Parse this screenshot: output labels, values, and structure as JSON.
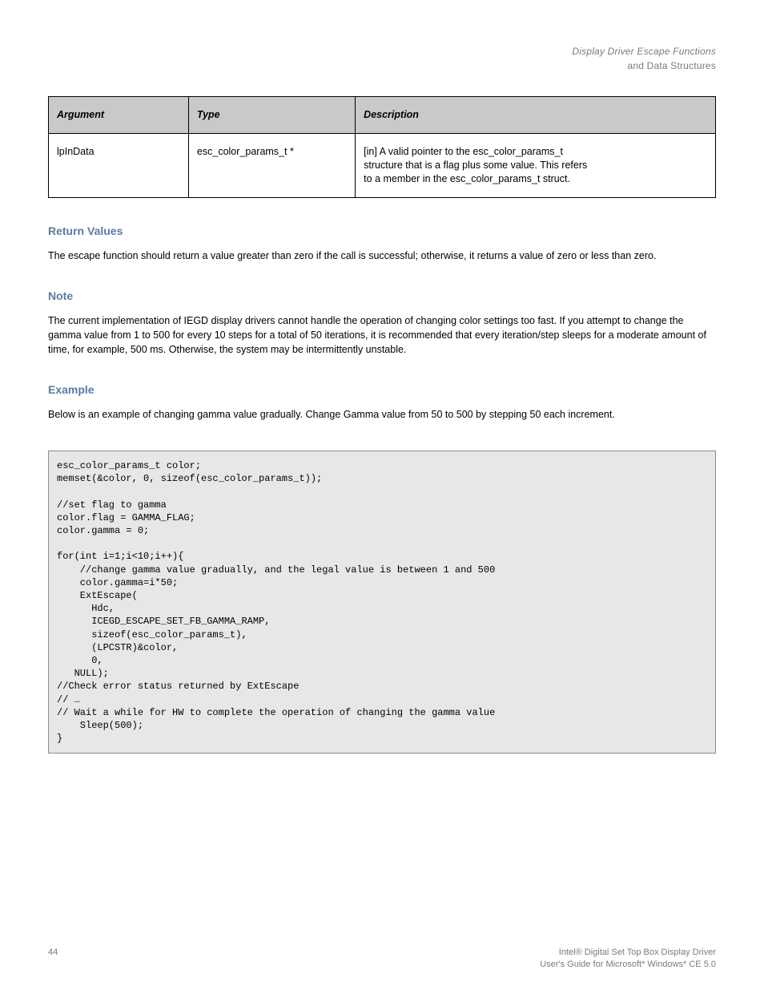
{
  "header": {
    "title_line1": "Display Driver Escape Functions",
    "title_line2": "and Data Structures"
  },
  "table": {
    "cols": {
      "arg": "Argument",
      "type": "Type",
      "desc": "Description"
    },
    "row": {
      "arg": "lpInData",
      "type": "esc_color_params_t *",
      "desc_line1": "[in] A valid pointer to the esc_color_params_t",
      "desc_line2": "structure that is a flag plus some value. This refers",
      "desc_line3": "to a member in the esc_color_params_t struct."
    }
  },
  "sections": {
    "return_h": "Return Values",
    "return_body": "The escape function should return a value greater than zero if the call is successful; otherwise, it returns a value of zero or less than zero.",
    "note_h": "Note",
    "note_body": "The current implementation of IEGD display drivers cannot handle the operation of changing color settings too fast. If you attempt to change the gamma value from 1 to 500 for every 10 steps for a total of 50 iterations, it is recommended that every iteration/step sleeps for a moderate amount of time, for example, 500 ms. Otherwise, the system may be intermittently unstable.",
    "example_h": "Example",
    "example_body": "Below is an example of changing gamma value gradually. Change Gamma value from 50 to 500 by stepping 50 each increment."
  },
  "code": "esc_color_params_t color;\nmemset(&color, 0, sizeof(esc_color_params_t));\n\n//set flag to gamma\ncolor.flag = GAMMA_FLAG;\ncolor.gamma = 0;\n\nfor(int i=1;i<10;i++){\n    //change gamma value gradually, and the legal value is between 1 and 500\n    color.gamma=i*50;\n    ExtEscape(\n      Hdc,\n      ICEGD_ESCAPE_SET_FB_GAMMA_RAMP,\n      sizeof(esc_color_params_t),\n      (LPCSTR)&color,\n      0,\n   NULL);\n//Check error status returned by ExtEscape\n// …\n// Wait a while for HW to complete the operation of changing the gamma value\n    Sleep(500);\n}",
  "footer": {
    "left": "44",
    "right_line1": "Intel® Digital Set Top Box Display Driver",
    "right_line2": "User's Guide for Microsoft* Windows* CE 5.0"
  }
}
